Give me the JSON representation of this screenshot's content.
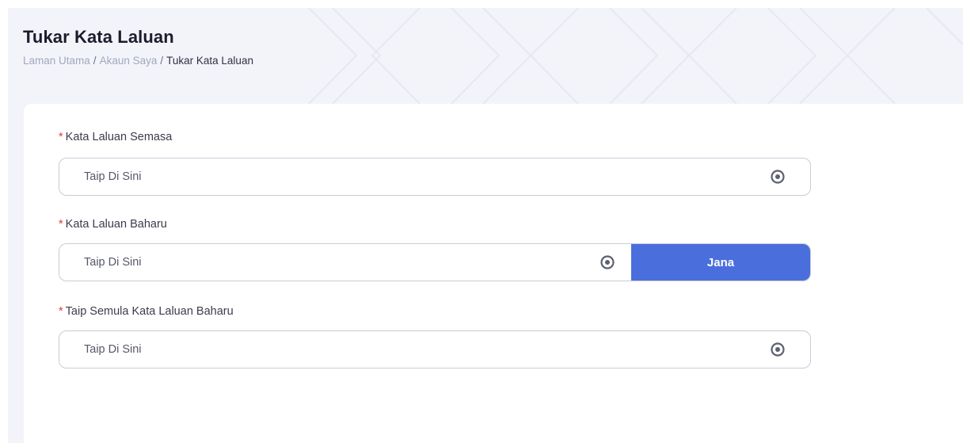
{
  "page": {
    "title": "Tukar Kata Laluan",
    "breadcrumb": [
      {
        "label": "Laman Utama"
      },
      {
        "label": "Akaun Saya"
      },
      {
        "label": "Tukar Kata Laluan"
      }
    ],
    "breadcrumb_separator": "/"
  },
  "form": {
    "required_marker": "*",
    "current_password": {
      "label": "Kata Laluan Semasa",
      "placeholder": "Taip Di Sini",
      "value": ""
    },
    "new_password": {
      "label": "Kata Laluan Baharu",
      "placeholder": "Taip Di Sini",
      "value": "",
      "generate_label": "Jana"
    },
    "confirm_password": {
      "label": "Taip Semula Kata Laluan Baharu",
      "placeholder": "Taip Di Sini",
      "value": ""
    }
  },
  "icons": {
    "toggle_visibility": "eye-icon"
  },
  "colors": {
    "primary": "#4a6fdc",
    "required": "#e53935",
    "background": "#f3f4fa",
    "breadcrumb_muted": "#a2a7be"
  }
}
